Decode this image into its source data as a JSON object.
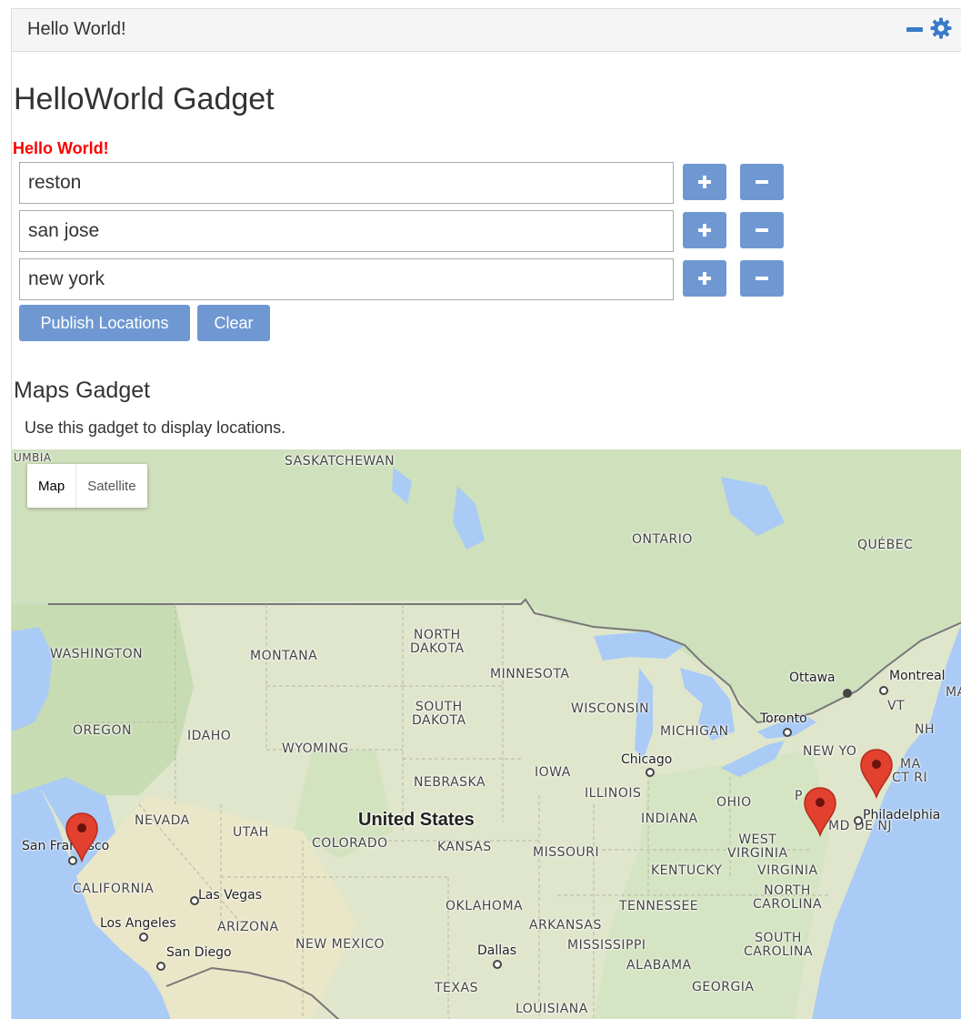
{
  "panel": {
    "title": "Hello World!",
    "minimize_icon": "minus-icon",
    "settings_icon": "gear-icon",
    "accent": "#3a7bc8"
  },
  "gadget": {
    "title": "HelloWorld Gadget",
    "hello_label": "Hello World!",
    "locations": [
      "reston",
      "san jose",
      "new york"
    ],
    "add_icon": "plus-icon",
    "remove_icon": "minus-icon",
    "publish_label": "Publish Locations",
    "clear_label": "Clear",
    "button_color": "#6f98d2"
  },
  "maps": {
    "title": "Maps Gadget",
    "description": "Use this gadget to display locations.",
    "map_type_options": [
      "Map",
      "Satellite"
    ],
    "selected_map_type": "Map",
    "labels": {
      "saskatchewan": "SASKATCHEWAN",
      "columbia": "UMBIA",
      "ontario": "ONTARIO",
      "quebec": "QUÉBEC",
      "washington": "WASHINGTON",
      "montana": "MONTANA",
      "north_dakota": "NORTH\nDAKOTA",
      "minnesota": "MINNESOTA",
      "ottawa": "Ottawa",
      "montreal": "Montreal",
      "mai": "MAI",
      "vt": "VT",
      "nh": "NH",
      "south_dakota": "SOUTH\nDAKOTA",
      "wisconsin": "WISCONSIN",
      "toronto": "Toronto",
      "oregon": "OREGON",
      "idaho": "IDAHO",
      "michigan": "MICHIGAN",
      "new_york": "NEW YO",
      "ma": "MA",
      "wyoming": "WYOMING",
      "chicago": "Chicago",
      "ct_ri": "CT RI",
      "iowa": "IOWA",
      "nebraska": "NEBRASKA",
      "illinois": "ILLINOIS",
      "ohio": "OHIO",
      "p": "P",
      "nevada": "NEVADA",
      "united_states": "United States",
      "indiana": "INDIANA",
      "philadelphia": "Philadelphia",
      "utah": "UTAH",
      "colorado": "COLORADO",
      "kansas": "KANSAS",
      "missouri": "MISSOURI",
      "west_virginia": "WEST\nVIRGINIA",
      "md_de_nj": "MD  DE NJ",
      "san_francisco": "San Francisco",
      "california": "CALIFORNIA",
      "las_vegas": "Las Vegas",
      "kentucky": "KENTUCKY",
      "virginia": "VIRGINIA",
      "oklahoma": "OKLAHOMA",
      "tennessee": "TENNESSEE",
      "north_carolina": "NORTH\nCAROLINA",
      "los_angeles": "Los Angeles",
      "arizona": "ARIZONA",
      "arkansas": "ARKANSAS",
      "san_diego": "San Diego",
      "new_mexico": "NEW MEXICO",
      "dallas": "Dallas",
      "mississippi": "MISSISSIPPI",
      "south_carolina": "SOUTH\nCAROLINA",
      "alabama": "ALABAMA",
      "texas": "TEXAS",
      "georgia": "GEORGIA",
      "louisiana": "LOUISIANA"
    },
    "marker_color": "#e2412f"
  }
}
